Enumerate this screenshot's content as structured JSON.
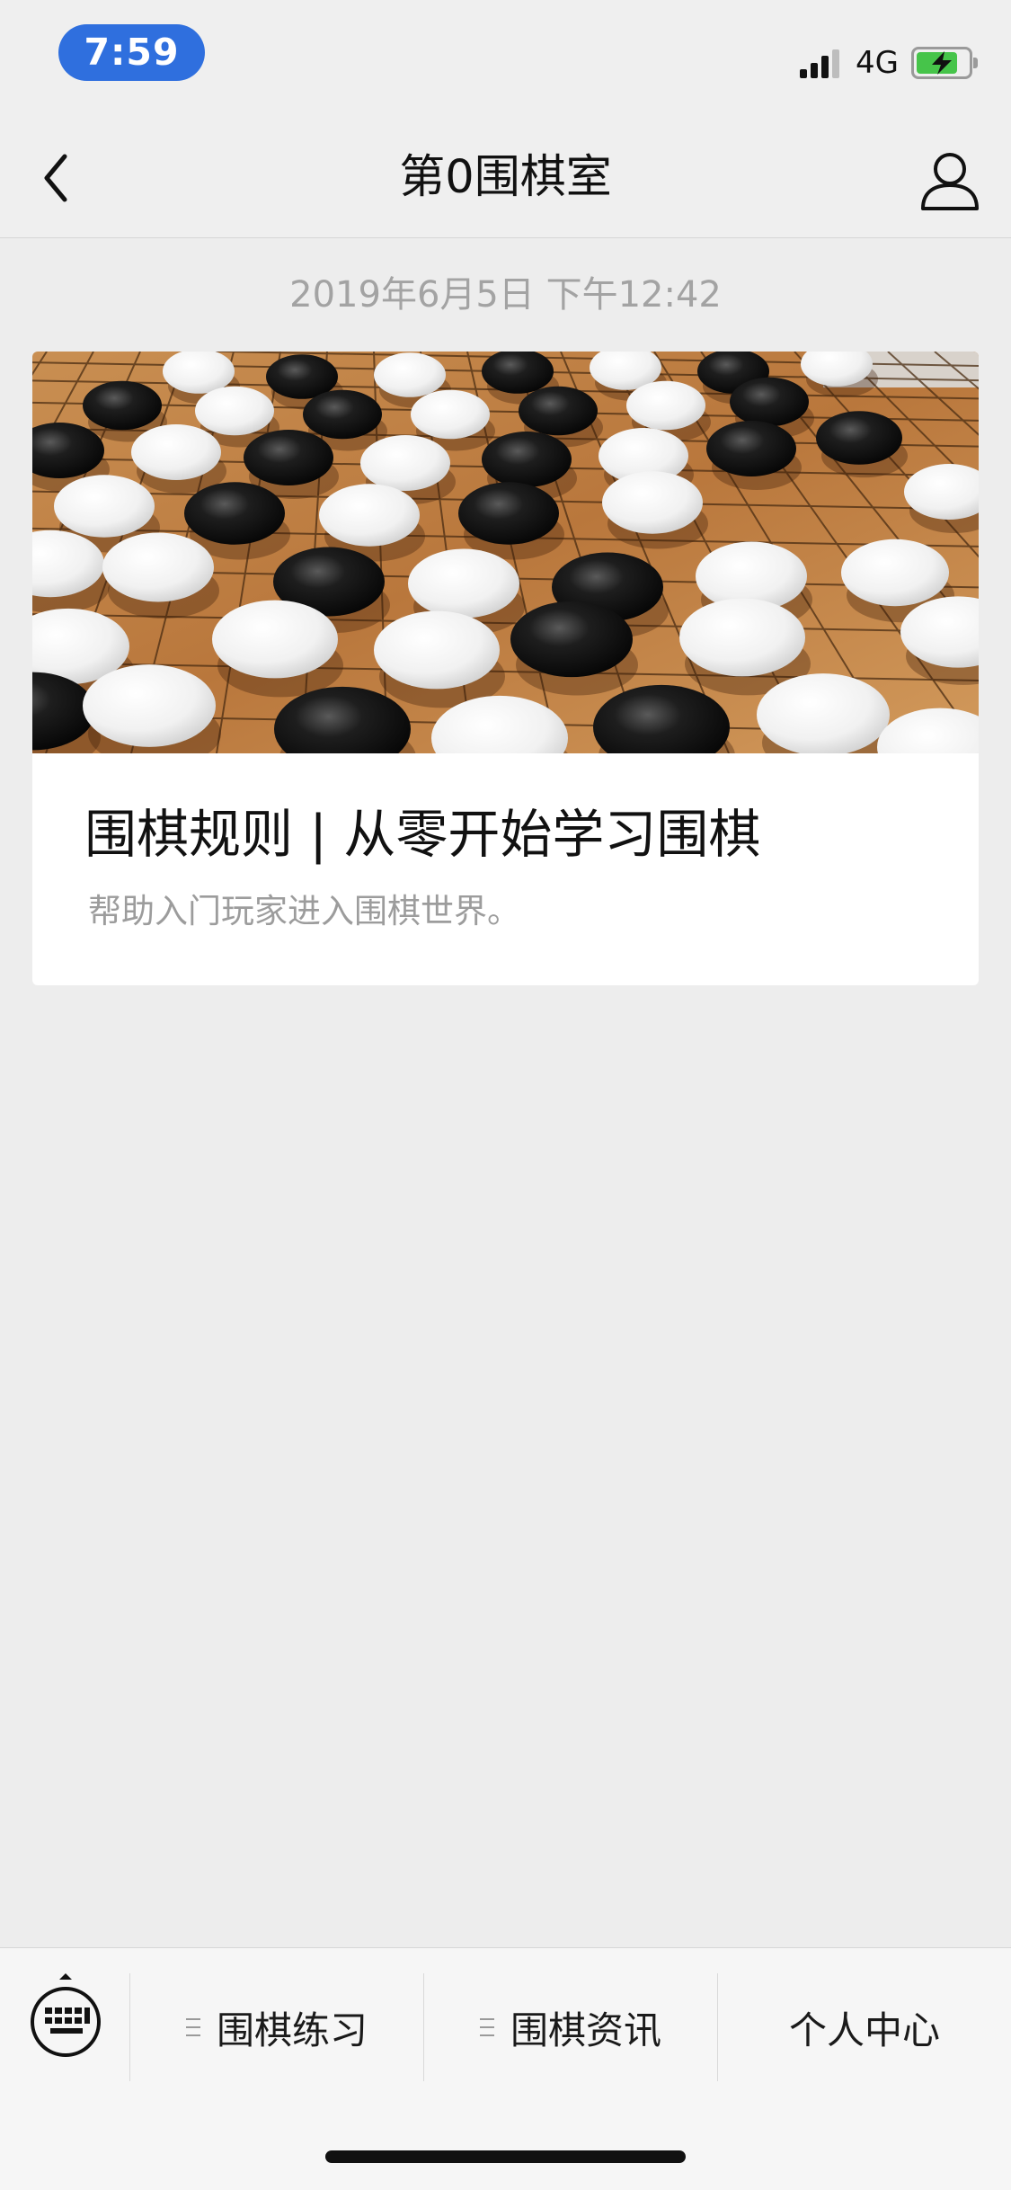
{
  "status_bar": {
    "time": "7:59",
    "network": "4G",
    "signal_bars_active": 3,
    "signal_bars_total": 4,
    "battery_level": 0.9,
    "battery_charging": true,
    "time_pill_color": "#2f6fde",
    "battery_color": "#46c44a"
  },
  "nav": {
    "title": "第0围棋室",
    "back_icon": "chevron-left-icon",
    "profile_icon": "user-icon"
  },
  "message": {
    "timestamp": "2019年6月5日 下午12:42",
    "article": {
      "title": "围棋规则 | 从零开始学习围棋",
      "description": "帮助入门玩家进入围棋世界。",
      "cover_icon": "go-board-photo"
    }
  },
  "menu": {
    "keyboard_icon": "keyboard-icon",
    "items": [
      {
        "label": "围棋练习",
        "has_submenu": true
      },
      {
        "label": "围棋资讯",
        "has_submenu": true
      },
      {
        "label": "个人中心",
        "has_submenu": false
      }
    ]
  }
}
